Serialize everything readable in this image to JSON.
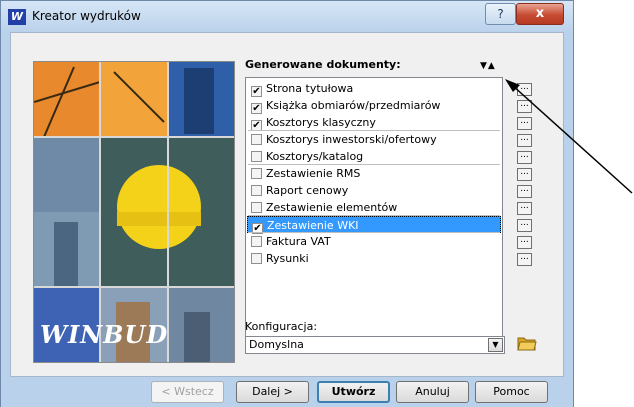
{
  "window": {
    "title": "Kreator wydruków",
    "help_glyph": "?",
    "close_glyph": "x",
    "icon_glyph": "W"
  },
  "image_panel": {
    "logo_text": "WINBUD"
  },
  "documents": {
    "title": "Generowane dokumenty:",
    "sort_glyph": "▼▲",
    "items": [
      {
        "label": "Strona tytułowa",
        "checked": true
      },
      {
        "label": "Książka obmiarów/przedmiarów",
        "checked": true
      },
      {
        "label": "Kosztorys klasyczny",
        "checked": true
      },
      {
        "label": "Kosztorys inwestorski/ofertowy",
        "checked": false
      },
      {
        "label": "Kosztorys/katalog",
        "checked": false
      },
      {
        "label": "Zestawienie RMS",
        "checked": false
      },
      {
        "label": "Raport cenowy",
        "checked": false
      },
      {
        "label": "Zestawienie elementów",
        "checked": false
      },
      {
        "label": "Zestawienie WKI",
        "checked": true,
        "selected": true
      },
      {
        "label": "Faktura VAT",
        "checked": false
      },
      {
        "label": "Rysunki",
        "checked": false
      }
    ],
    "dots_label": "..."
  },
  "config": {
    "label": "Konfiguracja:",
    "value": "Domyslna"
  },
  "buttons": {
    "back": "< Wstecz",
    "next": "Dalej >",
    "create": "Utwórz",
    "cancel": "Anuluj",
    "help": "Pomoc"
  },
  "colors": {
    "selection": "#3399ff",
    "frame": "#b9d1ea",
    "close_red": "#c84b33"
  }
}
